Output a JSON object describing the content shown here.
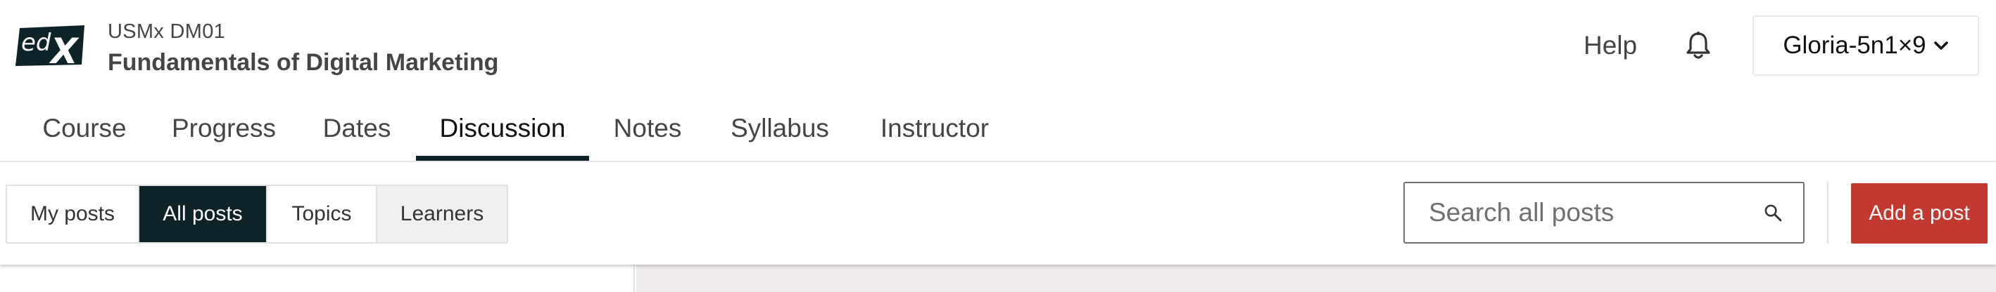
{
  "header": {
    "logo_text": "edX",
    "course_org": "USMx DM01",
    "course_title": "Fundamentals of Digital Marketing",
    "help_label": "Help",
    "user_name": "Gloria-5n1×9",
    "icons": {
      "logo": "edx-logo",
      "notifications": "bell-icon",
      "user_menu": "chevron-down-icon"
    }
  },
  "tabs": [
    {
      "label": "Course"
    },
    {
      "label": "Progress"
    },
    {
      "label": "Dates"
    },
    {
      "label": "Discussion",
      "active": true
    },
    {
      "label": "Notes"
    },
    {
      "label": "Syllabus"
    },
    {
      "label": "Instructor"
    }
  ],
  "discussion_nav": {
    "filters": [
      {
        "label": "My posts"
      },
      {
        "label": "All posts",
        "active": true
      },
      {
        "label": "Topics"
      },
      {
        "label": "Learners"
      }
    ],
    "search": {
      "placeholder": "Search all posts",
      "value": "",
      "icon": "search-icon"
    },
    "add_post_label": "Add a post"
  },
  "colors": {
    "brand_dark": "#0d2328",
    "add_post": "#c2392f",
    "text": "#454545",
    "content_bg": "#efeceb"
  }
}
